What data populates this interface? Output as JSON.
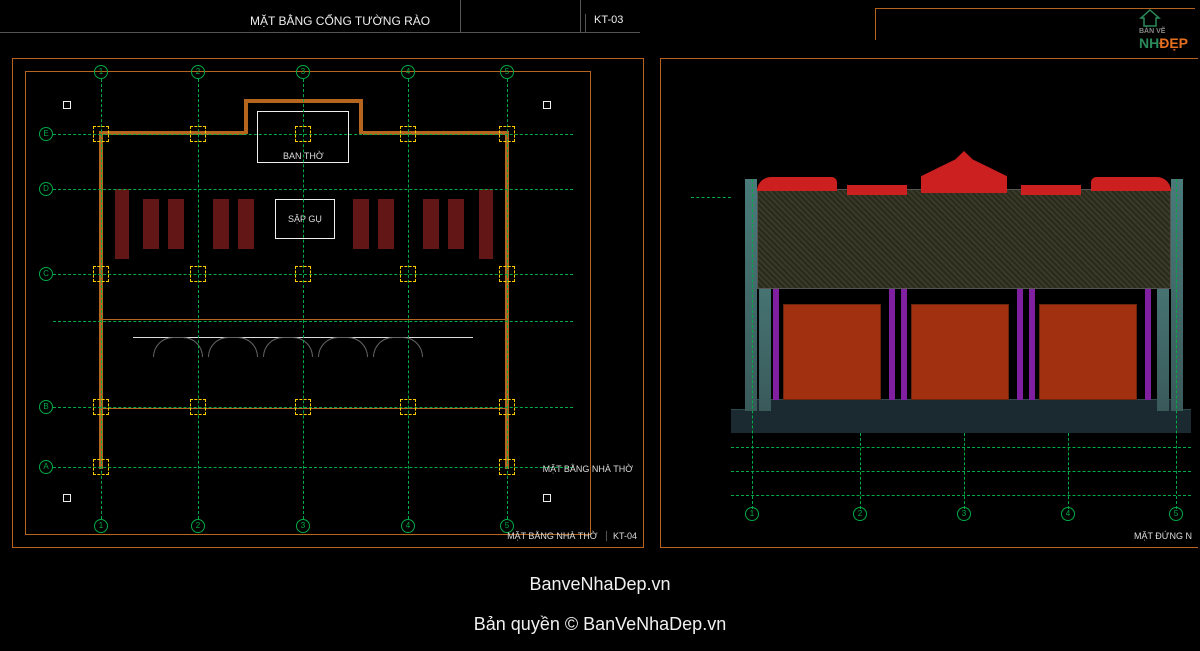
{
  "header": {
    "title": "MẶT BẰNG CỔNG TƯỜNG RÀO",
    "sheet_code": "KT-03"
  },
  "left_sheet": {
    "title_small": "MẶT BẰNG NHÀ THỜ",
    "sub_title": "MẶT BẰNG NHÀ THỜ",
    "sheet_code": "KT-04",
    "rooms": {
      "altar": "BAN THỜ",
      "platform": "SẬP GỤ"
    },
    "grid_cols": [
      "1",
      "2",
      "3",
      "4",
      "5"
    ],
    "grid_rows": [
      "A",
      "B",
      "C",
      "D",
      "E"
    ]
  },
  "right_sheet": {
    "title": "MẶT ĐỨNG N"
  },
  "watermarks": {
    "line1": "BanveNhaDep.vn",
    "line2": "Bản quyền © BanVeNhaDep.vn"
  },
  "logo": {
    "prefix": "BẢN VẼ",
    "main": "NH",
    "suffix": "ĐẸP"
  }
}
